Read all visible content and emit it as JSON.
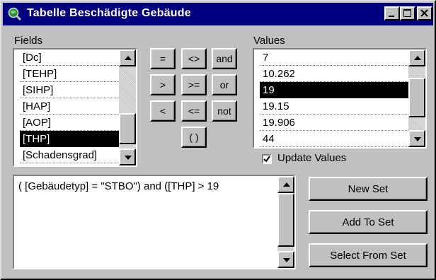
{
  "window": {
    "title": "Tabelle Beschädigte Gebäude",
    "icon": "globe-magnifier-icon",
    "controls": [
      "minimize-icon",
      "maximize-icon",
      "close-icon"
    ]
  },
  "fields": {
    "label": "Fields",
    "items": [
      "[Dc]",
      "[TEHP]",
      "[SIHP]",
      "[HAP]",
      "[AOP]",
      "[THP]",
      "[Schadensgrad]"
    ],
    "selected": "[THP]"
  },
  "operators": {
    "eq": "=",
    "ne": "<>",
    "and": "and",
    "gt": ">",
    "ge": ">=",
    "or": "or",
    "lt": "<",
    "le": "<=",
    "not": "not",
    "parens": "( )"
  },
  "values": {
    "label": "Values",
    "items": [
      "7",
      "10.262",
      "19",
      "19.15",
      "19.906",
      "44"
    ],
    "selected": "19",
    "update_label": "Update Values",
    "update_checked": true
  },
  "expression": {
    "text": "( [Gebäudetyp] = \"STBO\") and ([THP] > 19"
  },
  "actions": {
    "new_set": "New Set",
    "add_to_set": "Add To Set",
    "select_from_set": "Select From Set"
  }
}
